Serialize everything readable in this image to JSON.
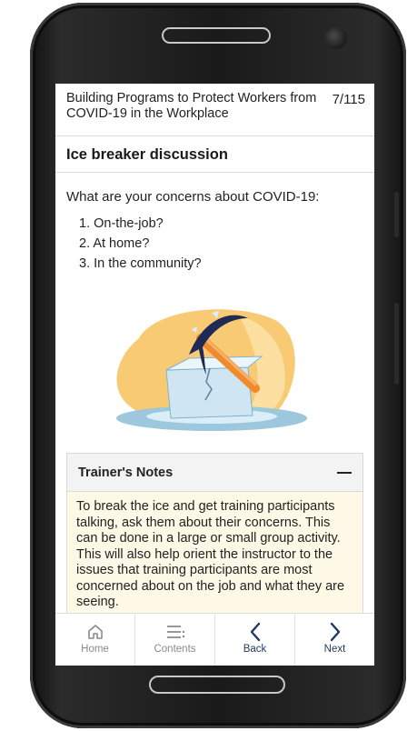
{
  "header": {
    "course_title": "Building Programs to Protect Workers from COVID-19 in the Workplace",
    "page_counter": "7/115"
  },
  "section": {
    "title": "Ice breaker discussion"
  },
  "content": {
    "prompt": "What are your concerns about COVID-19:",
    "questions": [
      "1. On-the-job?",
      "2. At home?",
      "3. In the community?"
    ]
  },
  "illustration": {
    "icon": "pickaxe-breaking-ice-icon",
    "colors": {
      "orange": "#f7c15c",
      "ice": "#cfe6f2",
      "water": "#9cc7dc",
      "handle": "#f08a2c",
      "head": "#1f2a55"
    }
  },
  "trainer_notes": {
    "title": "Trainer's Notes",
    "collapse_icon": "minus-icon",
    "body": "To break the ice and get training participants talking, ask them about their concerns. This can be done in a large or small group activity. This will also help orient the instructor to the issues that training participants are most concerned about on the job and what they are seeing."
  },
  "bottom_nav": {
    "home": "Home",
    "contents": "Contents",
    "back": "Back",
    "next": "Next"
  },
  "colors": {
    "nav_active": "#1f3a5c",
    "nav_muted": "#8a8a8a",
    "notes_bg": "#fdf9e6"
  }
}
